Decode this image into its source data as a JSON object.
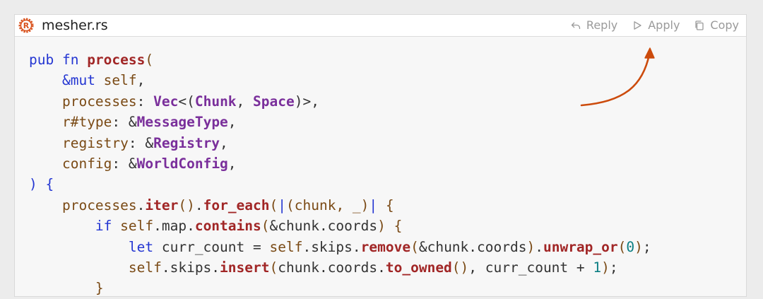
{
  "file": {
    "name": "mesher.rs",
    "icon": "rust-icon"
  },
  "actions": [
    {
      "label": "Reply",
      "icon": "reply-icon"
    },
    {
      "label": "Apply",
      "icon": "play-icon"
    },
    {
      "label": "Copy",
      "icon": "copy-icon"
    }
  ],
  "colors": {
    "keyword": "#2436d2",
    "function": "#a12626",
    "type": "#7a2f9b",
    "identifier": "#7a4a15",
    "number": "#0b7e83",
    "arrow": "#cc4b0c"
  },
  "code_lines": [
    [
      [
        "kw",
        "pub fn "
      ],
      [
        "fn",
        "process"
      ],
      [
        "id",
        "("
      ]
    ],
    [
      [
        "tx",
        "    "
      ],
      [
        "kw",
        "&mut "
      ],
      [
        "id",
        "self"
      ],
      [
        "tx",
        ","
      ]
    ],
    [
      [
        "tx",
        "    "
      ],
      [
        "id",
        "processes"
      ],
      [
        "tx",
        ": "
      ],
      [
        "ty",
        "Vec"
      ],
      [
        "tx",
        "<("
      ],
      [
        "ty",
        "Chunk"
      ],
      [
        "tx",
        ", "
      ],
      [
        "ty",
        "Space"
      ],
      [
        "tx",
        ")>,"
      ]
    ],
    [
      [
        "tx",
        "    "
      ],
      [
        "id",
        "r#type"
      ],
      [
        "tx",
        ": &"
      ],
      [
        "ty",
        "MessageType"
      ],
      [
        "tx",
        ","
      ]
    ],
    [
      [
        "tx",
        "    "
      ],
      [
        "id",
        "registry"
      ],
      [
        "tx",
        ": &"
      ],
      [
        "ty",
        "Registry"
      ],
      [
        "tx",
        ","
      ]
    ],
    [
      [
        "tx",
        "    "
      ],
      [
        "id",
        "config"
      ],
      [
        "tx",
        ": &"
      ],
      [
        "ty",
        "WorldConfig"
      ],
      [
        "tx",
        ","
      ]
    ],
    [
      [
        "kw",
        ") {"
      ]
    ],
    [
      [
        "tx",
        "    "
      ],
      [
        "id",
        "processes"
      ],
      [
        "tx",
        "."
      ],
      [
        "fn",
        "iter"
      ],
      [
        "id",
        "()"
      ],
      [
        "tx",
        "."
      ],
      [
        "fn",
        "for_each"
      ],
      [
        "id",
        "("
      ],
      [
        "kw",
        "|"
      ],
      [
        "id",
        "(chunk, _)"
      ],
      [
        "kw",
        "|"
      ],
      [
        "id",
        " {"
      ]
    ],
    [
      [
        "tx",
        "        "
      ],
      [
        "kw",
        "if "
      ],
      [
        "id",
        "self"
      ],
      [
        "tx",
        ".map."
      ],
      [
        "fn",
        "contains"
      ],
      [
        "id",
        "("
      ],
      [
        "tx",
        "&chunk.coords"
      ],
      [
        "id",
        ") {"
      ]
    ],
    [
      [
        "tx",
        "            "
      ],
      [
        "kw",
        "let "
      ],
      [
        "tx",
        "curr_count = "
      ],
      [
        "id",
        "self"
      ],
      [
        "tx",
        ".skips."
      ],
      [
        "fn",
        "remove"
      ],
      [
        "id",
        "("
      ],
      [
        "tx",
        "&chunk.coords"
      ],
      [
        "id",
        ")"
      ],
      [
        "tx",
        "."
      ],
      [
        "fn",
        "unwrap_or"
      ],
      [
        "id",
        "("
      ],
      [
        "nm",
        "0"
      ],
      [
        "id",
        ")"
      ],
      [
        "tx",
        ";"
      ]
    ],
    [
      [
        "tx",
        "            "
      ],
      [
        "id",
        "self"
      ],
      [
        "tx",
        ".skips."
      ],
      [
        "fn",
        "insert"
      ],
      [
        "id",
        "("
      ],
      [
        "tx",
        "chunk.coords."
      ],
      [
        "fn",
        "to_owned"
      ],
      [
        "id",
        "()"
      ],
      [
        "tx",
        ", curr_count + "
      ],
      [
        "nm",
        "1"
      ],
      [
        "id",
        ")"
      ],
      [
        "tx",
        ";"
      ]
    ],
    [
      [
        "tx",
        "        "
      ],
      [
        "id",
        "}"
      ]
    ]
  ]
}
